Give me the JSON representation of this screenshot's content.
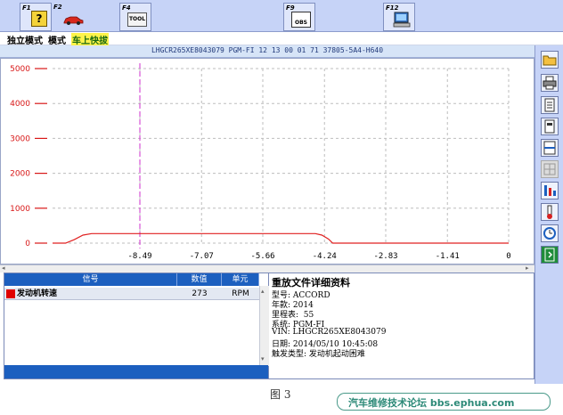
{
  "fkeys": [
    {
      "label": "F1",
      "icon": "help-icon"
    },
    {
      "label": "F2",
      "icon": "car-icon"
    },
    {
      "label": "F4",
      "icon": "tool-icon",
      "icon_text": "TOOL"
    },
    {
      "label": "F9",
      "icon": "obs-icon",
      "icon_text": "OBS"
    },
    {
      "label": "F12",
      "icon": "computer-icon"
    }
  ],
  "modebar": {
    "mode1": "独立模式",
    "mode2": "模式",
    "mode3": "车上快拔"
  },
  "info": {
    "text": "LHGCR265XE8043079  PGM-FI  12 13 00 01 71  37805-5A4-H640"
  },
  "chart_data": {
    "type": "line",
    "x_ticks": [
      -8.49,
      -7.07,
      -5.66,
      -4.24,
      -2.83,
      -1.41,
      0
    ],
    "x_tick_labels": [
      "-8.49",
      "-7.07",
      "-5.66",
      "-4.24",
      "-2.83",
      "-1.41",
      "0"
    ],
    "y_ticks": [
      0,
      1000,
      2000,
      3000,
      4000,
      5000
    ],
    "y_tick_labels": [
      "0",
      "1000",
      "2000",
      "3000",
      "4000",
      "5000"
    ],
    "xlim": [
      -10.5,
      0
    ],
    "ylim": [
      0,
      5000
    ],
    "grid": true,
    "marker_x": -8.49,
    "series": [
      {
        "color": "#e02020",
        "x": [
          -10.5,
          -10.2,
          -10.0,
          -9.8,
          -9.6,
          -4.45,
          -4.3,
          -4.15,
          -4.05,
          0
        ],
        "y": [
          0,
          0,
          100,
          230,
          273,
          273,
          230,
          120,
          0,
          0
        ]
      }
    ]
  },
  "table": {
    "headers": {
      "signal": "信号",
      "value": "数值",
      "unit": "单元"
    },
    "rows": [
      {
        "signal": "发动机转速",
        "value": "273",
        "unit": "RPM",
        "color": "#e00000"
      }
    ]
  },
  "details": {
    "title": "重放文件详细资料",
    "lines": [
      "型号: ACCORD",
      "年款: 2014",
      "里程表:  55",
      "系统: PGM-FI",
      "VIN: LHGCR265XE8043079",
      "日期: 2014/05/10 10:45:08",
      "触发类型: 发动机起动困难"
    ]
  },
  "right_tools": [
    "open-folder-icon",
    "print-icon",
    "report-icon",
    "document-icon",
    "split-view-icon",
    "grid-icon",
    "graph-settings-icon",
    "trigger-icon",
    "timer-icon",
    "exit-icon"
  ],
  "caption": "图 3",
  "watermark": "汽车维修技术论坛 bbs.ephua.com"
}
